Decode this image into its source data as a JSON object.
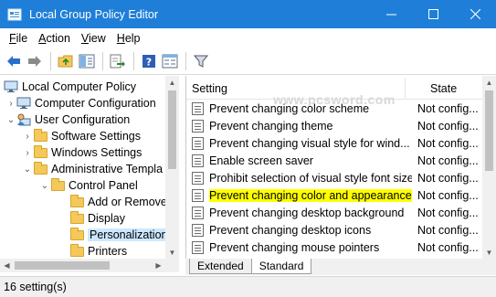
{
  "window": {
    "title": "Local Group Policy Editor",
    "accent": "#1f7fd8"
  },
  "menu": {
    "file": {
      "u": "F",
      "rest": "ile"
    },
    "action": {
      "u": "A",
      "rest": "ction"
    },
    "view": {
      "u": "V",
      "rest": "iew"
    },
    "help": {
      "u": "H",
      "rest": "elp"
    }
  },
  "toolbar": {
    "icons": [
      "back-arrow-icon",
      "forward-arrow-icon",
      "up-folder-icon",
      "show-hide-tree-icon",
      "export-list-icon",
      "help-icon",
      "properties-view-icon",
      "filter-icon"
    ]
  },
  "tree": {
    "items": [
      {
        "label": "Local Computer Policy",
        "chevron": "",
        "icon": "computer-icon"
      },
      {
        "label": "Computer Configuration",
        "chevron": "›",
        "icon": "computer-icon"
      },
      {
        "label": "User Configuration",
        "chevron": "⌄",
        "icon": "user-icon"
      },
      {
        "label": "Software Settings",
        "chevron": "›",
        "icon": "folder-icon"
      },
      {
        "label": "Windows Settings",
        "chevron": "›",
        "icon": "folder-icon"
      },
      {
        "label": "Administrative Templa",
        "chevron": "⌄",
        "icon": "folder-icon"
      },
      {
        "label": "Control Panel",
        "chevron": "⌄",
        "icon": "folder-icon"
      },
      {
        "label": "Add or Remove",
        "chevron": "",
        "icon": "folder-icon"
      },
      {
        "label": "Display",
        "chevron": "",
        "icon": "folder-icon"
      },
      {
        "label": "Personalization",
        "chevron": "",
        "icon": "folder-icon",
        "selected": true
      },
      {
        "label": "Printers",
        "chevron": "",
        "icon": "folder-icon"
      }
    ]
  },
  "list": {
    "columns": {
      "setting": "Setting",
      "state": "State"
    },
    "rows": [
      {
        "name": "Prevent changing color scheme",
        "state": "Not config..."
      },
      {
        "name": "Prevent changing theme",
        "state": "Not config..."
      },
      {
        "name": "Prevent changing visual style for wind...",
        "state": "Not config..."
      },
      {
        "name": "Enable screen saver",
        "state": "Not config..."
      },
      {
        "name": "Prohibit selection of visual style font size",
        "state": "Not config..."
      },
      {
        "name": "Prevent changing color and appearance",
        "state": "Not config...",
        "highlighted": true,
        "highlight_color": "#ffff00"
      },
      {
        "name": "Prevent changing desktop background",
        "state": "Not config..."
      },
      {
        "name": "Prevent changing desktop icons",
        "state": "Not config..."
      },
      {
        "name": "Prevent changing mouse pointers",
        "state": "Not config..."
      }
    ]
  },
  "tabs": {
    "extended": "Extended",
    "standard": "Standard",
    "active": "standard"
  },
  "status": {
    "text": "16 setting(s)"
  },
  "watermark": "www.pcsword.com"
}
